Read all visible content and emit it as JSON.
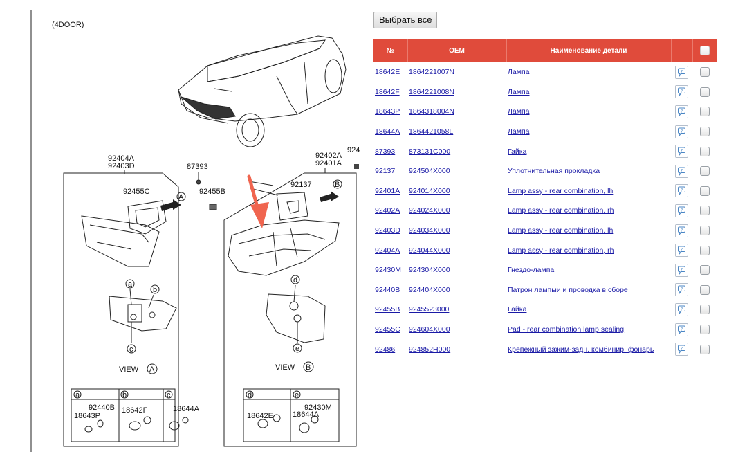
{
  "diagram": {
    "variant": "(4DOOR)",
    "labels": {
      "p92404A": "92404A",
      "p92403D": "92403D",
      "p87393": "87393",
      "p92455C": "92455C",
      "p92455B": "92455B",
      "p92402A": "92402A",
      "p92401A": "92401A",
      "p924_cut": "924",
      "p92137": "92137",
      "view_a": "VIEW",
      "view_b": "VIEW",
      "cA": "A",
      "cB": "B",
      "ca": "a",
      "cb": "b",
      "cc": "c",
      "cd": "d",
      "ce": "e",
      "bulb_a1": "92440B",
      "bulb_a2": "18643P",
      "bulb_b": "18642F",
      "bulb_c": "18644A",
      "bulb_d": "18642E",
      "bulb_e1": "92430M",
      "bulb_e2": "18644A"
    }
  },
  "toolbar": {
    "select_all_label": "Выбрать все"
  },
  "table": {
    "headers": {
      "num": "№",
      "oem": "OEM",
      "name": "Наименование детали"
    },
    "rows": [
      {
        "num": "18642E",
        "oem": "1864221007N",
        "name": "Лампа"
      },
      {
        "num": "18642F",
        "oem": "1864221008N",
        "name": "Лампа"
      },
      {
        "num": "18643P",
        "oem": "1864318004N",
        "name": "Лампа"
      },
      {
        "num": "18644A",
        "oem": "1864421058L",
        "name": "Лампа"
      },
      {
        "num": "87393",
        "oem": "873131C000",
        "name": "Гайка"
      },
      {
        "num": "92137",
        "oem": "924504X000",
        "name": "Уплотнительная прокладка"
      },
      {
        "num": "92401A",
        "oem": "924014X000",
        "name": "Lamp assy - rear combination, lh"
      },
      {
        "num": "92402A",
        "oem": "924024X000",
        "name": "Lamp assy - rear combination, rh"
      },
      {
        "num": "92403D",
        "oem": "924034X000",
        "name": "Lamp assy - rear combination, lh"
      },
      {
        "num": "92404A",
        "oem": "924044X000",
        "name": "Lamp assy - rear combination, rh"
      },
      {
        "num": "92430M",
        "oem": "924304X000",
        "name": "Гнездо-лампа"
      },
      {
        "num": "92440B",
        "oem": "924404X000",
        "name": "Патрон лампыи и проводка в сборе"
      },
      {
        "num": "92455B",
        "oem": "9245523000",
        "name": "Гайка"
      },
      {
        "num": "92455C",
        "oem": "924604X000",
        "name": "Pad - rear combination lamp sealing"
      },
      {
        "num": "92486",
        "oem": "924852H000",
        "name": "Крепежный зажим-задн. комбинир. фонарь"
      }
    ]
  },
  "colors": {
    "header_bg": "#e04b3b",
    "link": "#1a1aa6",
    "arrow": "#f0654f"
  },
  "icons": {
    "comment": "speech-bubble-icon",
    "checkbox": "checkbox-icon",
    "pointer_arrow": "red-arrow-icon"
  }
}
